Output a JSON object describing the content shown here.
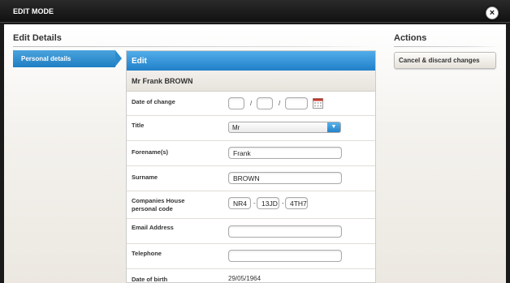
{
  "window": {
    "title": "EDIT MODE",
    "close_glyph": "×"
  },
  "left": {
    "heading": "Edit Details",
    "nav_items": [
      {
        "label": "Personal details"
      }
    ]
  },
  "form": {
    "header": "Edit",
    "person_name": "Mr Frank BROWN",
    "fields": {
      "date_of_change": {
        "label": "Date of change",
        "day": "",
        "month": "",
        "year": "",
        "sep": "/"
      },
      "title": {
        "label": "Title",
        "value": "Mr"
      },
      "forenames": {
        "label": "Forename(s)",
        "value": "Frank"
      },
      "surname": {
        "label": "Surname",
        "value": "BROWN"
      },
      "ch_code": {
        "label_line1": "Companies House",
        "label_line2": "personal code",
        "part1": "NR4",
        "part2": "13JD",
        "part3": "4TH7",
        "sep": "-"
      },
      "email": {
        "label": "Email Address",
        "value": ""
      },
      "telephone": {
        "label": "Telephone",
        "value": ""
      },
      "dob": {
        "label": "Date of birth",
        "value": "29/05/1964"
      }
    }
  },
  "actions": {
    "heading": "Actions",
    "cancel_label": "Cancel & discard changes"
  },
  "colors": {
    "accent": "#2180c8",
    "topbar": "#111111"
  },
  "icons": {
    "close": "close-icon",
    "calendar": "calendar-icon",
    "dropdown": "chevron-down-icon"
  }
}
